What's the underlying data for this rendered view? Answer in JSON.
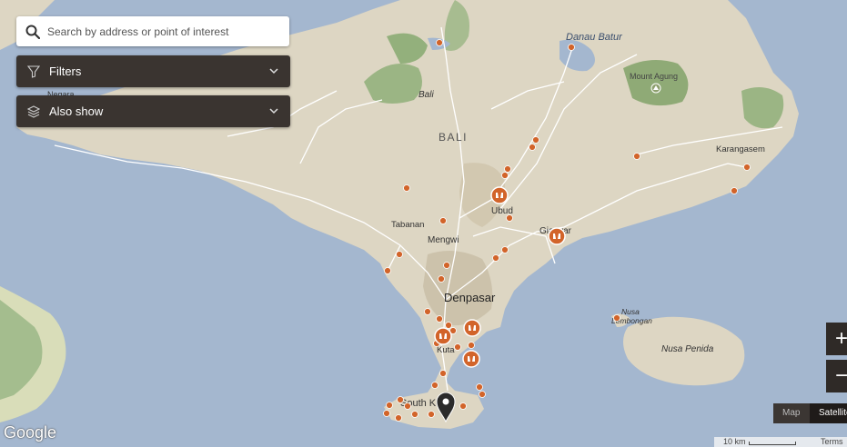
{
  "search": {
    "placeholder": "Search by address or point of interest"
  },
  "filters": {
    "label": "Filters"
  },
  "also_show": {
    "label": "Also show"
  },
  "map_labels": {
    "danau_batur": "Danau Batur",
    "mount_agung": "Mount Agung",
    "bali_region": "Bali",
    "bali_island": "BALI",
    "karangasem": "Karangasem",
    "negara": "Negara",
    "tabanan": "Tabanan",
    "mengwi": "Mengwi",
    "ubud": "Ubud",
    "gianyar": "Gianyar",
    "denpasar": "Denpasar",
    "kuta": "Kuta",
    "south_kuta": "South Kuta",
    "nusa_lembongan_1": "Nusa",
    "nusa_lembongan_2": "Lembongan",
    "nusa_penida": "Nusa Penida"
  },
  "zoom": {
    "in": "+",
    "out": "−"
  },
  "map_type": {
    "map": "Map",
    "satellite": "Satellite"
  },
  "footer": {
    "scale": "10 km",
    "terms": "Terms",
    "logo": "Google"
  },
  "colors": {
    "sea": "#a4b7cf",
    "land": "#ddd6c3",
    "forest": "#8fae80",
    "road": "#ffffff",
    "marker": "#d2642a",
    "panel": "#3a3430"
  }
}
